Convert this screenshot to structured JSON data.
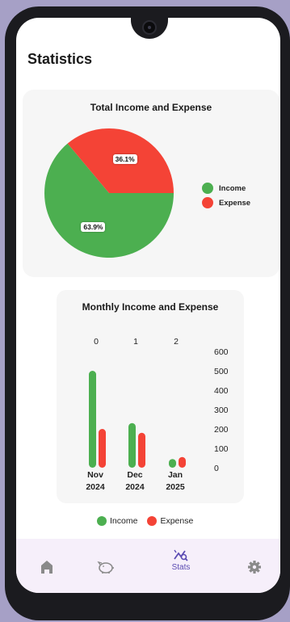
{
  "page": {
    "title": "Statistics"
  },
  "pie_card": {
    "title": "Total Income and Expense",
    "legend": [
      {
        "label": "Income",
        "color": "#4caf50"
      },
      {
        "label": "Expense",
        "color": "#f44336"
      }
    ]
  },
  "bar_card": {
    "title": "Monthly Income and Expense",
    "legend": [
      {
        "label": "Income",
        "color": "#4caf50"
      },
      {
        "label": "Expense",
        "color": "#f44336"
      }
    ]
  },
  "nav": {
    "items": [
      {
        "icon": "home-icon",
        "label": ""
      },
      {
        "icon": "piggy-bank-icon",
        "label": ""
      },
      {
        "icon": "stats-icon",
        "label": "Stats",
        "active": true
      },
      {
        "icon": "gear-icon",
        "label": ""
      }
    ],
    "active_color": "#5b4bb3",
    "inactive_color": "#8a8a8a"
  },
  "chart_data": [
    {
      "type": "pie",
      "title": "Total Income and Expense",
      "slices": [
        {
          "label": "Income",
          "value": 63.9,
          "display": "63.9%",
          "color": "#4caf50"
        },
        {
          "label": "Expense",
          "value": 36.1,
          "display": "36.1%",
          "color": "#f44336"
        }
      ],
      "legend_position": "right"
    },
    {
      "type": "bar",
      "title": "Monthly Income and Expense",
      "top_ticks": [
        "0",
        "1",
        "2"
      ],
      "categories": [
        "Nov\n2024",
        "Dec\n2024",
        "Jan\n2025"
      ],
      "category_lines": [
        [
          "Nov",
          "2024"
        ],
        [
          "Dec",
          "2024"
        ],
        [
          "Jan",
          "2025"
        ]
      ],
      "series": [
        {
          "name": "Income",
          "color": "#4caf50",
          "values": [
            500,
            230,
            45
          ]
        },
        {
          "name": "Expense",
          "color": "#f44336",
          "values": [
            200,
            180,
            55
          ]
        }
      ],
      "y_ticks": [
        "600",
        "500",
        "400",
        "300",
        "200",
        "100",
        "0"
      ],
      "ylim": [
        0,
        600
      ],
      "y_axis_position": "right",
      "grid": false,
      "legend_position": "bottom"
    }
  ]
}
